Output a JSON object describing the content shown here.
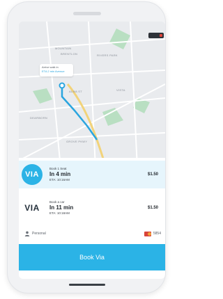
{
  "map": {
    "streets": [
      "Mountain",
      "Brentlon",
      "Rivers Park",
      "Alma St",
      "Vista",
      "Dearborn",
      "Grove Pkwy"
    ],
    "pickup": {
      "line1": "Arrive walk in",
      "line2": "ETA 2 min  Avenue"
    }
  },
  "rides": [
    {
      "logo": "VIA",
      "type": "Book 1 Seat",
      "time": "In 4 min",
      "eta": "ETA: 10:16AM",
      "price": "$1.50",
      "selected": true
    },
    {
      "logo": "VIA",
      "type": "Book a car",
      "time": "In 11 min",
      "eta": "ETA: 10:18AM",
      "price": "$1.50",
      "selected": false
    }
  ],
  "payment": {
    "label": "Personal",
    "card_last4": "5854"
  },
  "book_button": {
    "label": "Book Via"
  },
  "colors": {
    "brand": "#2bb3e6",
    "selected_row": "#e6f5fc",
    "route": "#2aa5df"
  },
  "icons": {
    "person": "person-icon",
    "card": "credit-card-icon"
  }
}
